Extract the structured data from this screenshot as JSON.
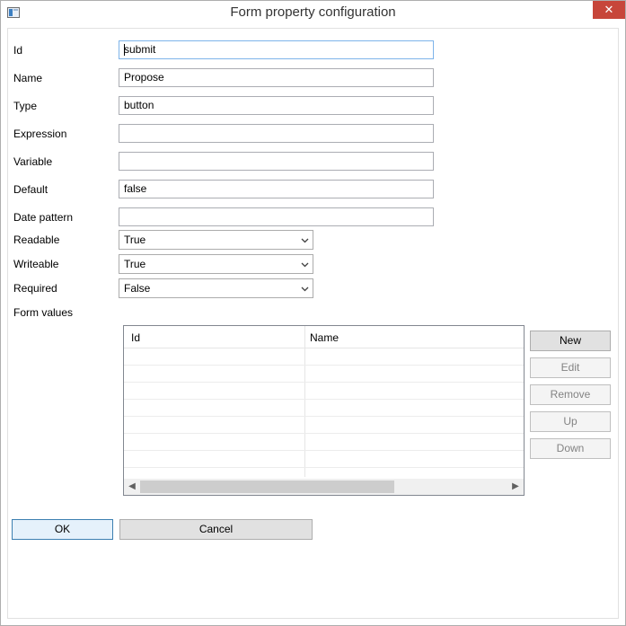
{
  "window": {
    "title": "Form property configuration",
    "close_glyph": "✕"
  },
  "fields": {
    "id": {
      "label": "Id",
      "value": "submit"
    },
    "name": {
      "label": "Name",
      "value": "Propose"
    },
    "type": {
      "label": "Type",
      "value": "button"
    },
    "expression": {
      "label": "Expression",
      "value": ""
    },
    "variable": {
      "label": "Variable",
      "value": ""
    },
    "default": {
      "label": "Default",
      "value": "false"
    },
    "date_pattern": {
      "label": "Date pattern",
      "value": ""
    }
  },
  "selects": {
    "readable": {
      "label": "Readable",
      "value": "True"
    },
    "writeable": {
      "label": "Writeable",
      "value": "True"
    },
    "required": {
      "label": "Required",
      "value": "False"
    }
  },
  "form_values": {
    "label": "Form values",
    "columns": [
      "Id",
      "Name"
    ],
    "rows": []
  },
  "side_buttons": {
    "new": "New",
    "edit": "Edit",
    "remove": "Remove",
    "up": "Up",
    "down": "Down"
  },
  "footer": {
    "ok": "OK",
    "cancel": "Cancel"
  }
}
